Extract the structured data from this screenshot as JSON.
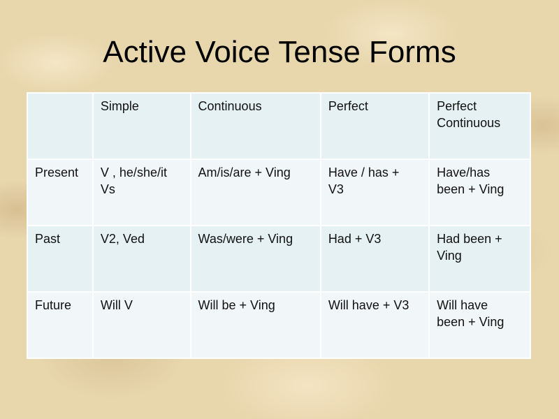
{
  "slide": {
    "title": "Active Voice Tense Forms"
  },
  "table": {
    "headers": [
      "",
      "Simple",
      "Continuous",
      "Perfect",
      "Perfect Continuous"
    ],
    "rows": [
      {
        "label": "Present",
        "cells": [
          "V , he/she/it Vs",
          "Am/is/are + Ving",
          "Have / has + V3",
          "Have/has been + Ving"
        ]
      },
      {
        "label": "Past",
        "cells": [
          "V2, Ved",
          "Was/were + Ving",
          "Had + V3",
          "Had been + Ving"
        ]
      },
      {
        "label": "Future",
        "cells": [
          "Will V",
          "Will be + Ving",
          "Will have + V3",
          "Will have been + Ving"
        ]
      }
    ]
  },
  "colors": {
    "row_band": "#e5f1f3",
    "row_light": "#f1f6f9",
    "background": "#e8d6ad"
  }
}
